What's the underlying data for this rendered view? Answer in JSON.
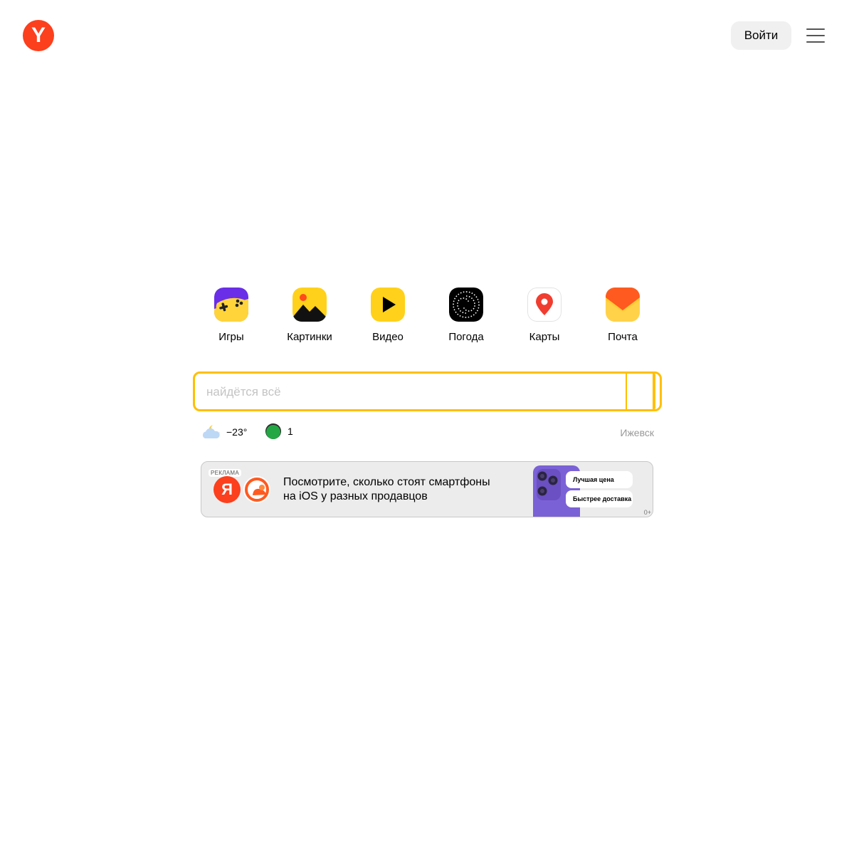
{
  "header": {
    "logo_letter": "Y",
    "login_label": "Войти"
  },
  "services": [
    {
      "label": "Игры",
      "icon": "games-icon"
    },
    {
      "label": "Картинки",
      "icon": "images-icon"
    },
    {
      "label": "Видео",
      "icon": "video-icon"
    },
    {
      "label": "Погода",
      "icon": "weather-icon"
    },
    {
      "label": "Карты",
      "icon": "maps-icon"
    },
    {
      "label": "Почта",
      "icon": "mail-icon"
    }
  ],
  "search": {
    "placeholder": "найдётся всё",
    "value": ""
  },
  "info": {
    "temperature": "−23°",
    "traffic_score": "1",
    "city": "Ижевск"
  },
  "ad": {
    "label": "РЕКЛАМА",
    "ya_letter": "Я",
    "text_line1": "Посмотрите, сколько стоят смартфоны",
    "text_line2": "на iOS у разных продавцов",
    "pill1": "Лучшая цена",
    "pill2": "Быстрее доставка",
    "age": "0+"
  },
  "colors": {
    "brand_red": "#fc3f1d",
    "search_border": "#ffbf00"
  }
}
